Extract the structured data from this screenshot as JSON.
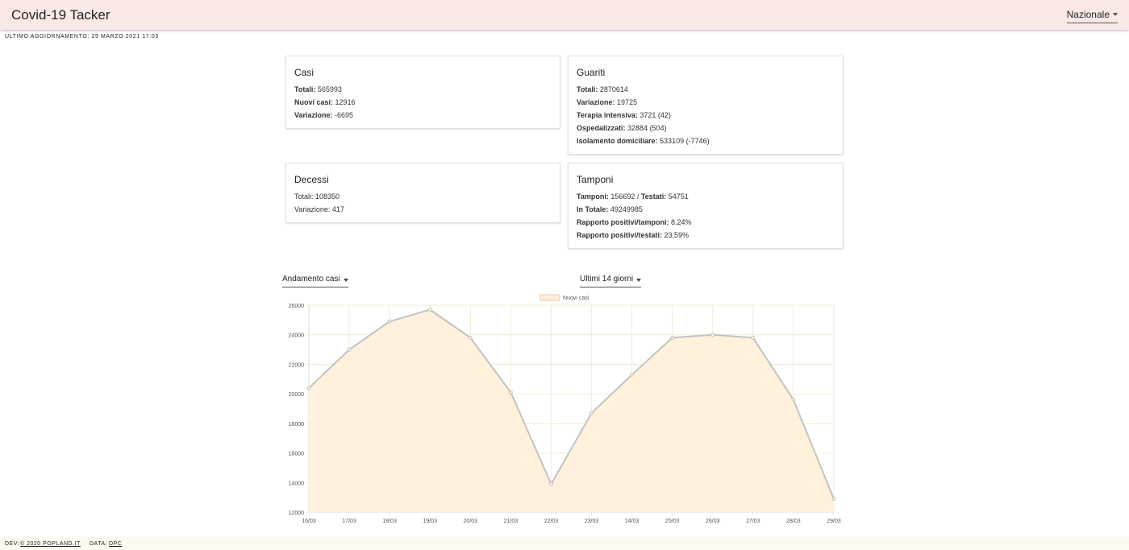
{
  "header": {
    "title": "Covid-19 Tacker",
    "scope_select": "Nazionale"
  },
  "last_update": "ULTIMO AGGIORNAMENTO: 29 MARZO 2021 17:03",
  "cards": {
    "casi": {
      "title": "Casi",
      "rows": [
        {
          "label": "Totali:",
          "value": "565993"
        },
        {
          "label": "Nuovi casi:",
          "value": "12916"
        },
        {
          "label": "Variazione:",
          "value": "-6695"
        }
      ]
    },
    "guariti": {
      "title": "Guariti",
      "rows": [
        {
          "label": "Totali:",
          "value": "2870614"
        },
        {
          "label": "Variazione:",
          "value": "19725"
        },
        {
          "label": "Terapia intensiva:",
          "value": "3721 (42)"
        },
        {
          "label": "Ospedalizzati:",
          "value": "32884 (504)"
        },
        {
          "label": "Isolamento domiciliare:",
          "value": "533109 (-7746)"
        }
      ]
    },
    "decessi": {
      "title": "Decessi",
      "rows": [
        {
          "text": "Totali: 108350"
        },
        {
          "text": "Variazione: 417"
        }
      ]
    },
    "tamponi": {
      "title": "Tamponi",
      "line1": {
        "label": "Tamponi:",
        "value": "156692 /",
        "label2": "Testati:",
        "value2": "54751"
      },
      "rows": [
        {
          "label": "In Totale:",
          "value": "49249985"
        },
        {
          "label": "Rapporto positivi/tamponi:",
          "value": "8.24%"
        },
        {
          "label": "Rapporto positivi/testati:",
          "value": "23.59%"
        }
      ]
    }
  },
  "controls": {
    "metric_select": "Andamento casi",
    "period_select": "Ultimi 14 giorni"
  },
  "colors": {
    "header_bg": "#fbe9e7",
    "area_fill": "#fff1dc",
    "line": "#c2c2c2"
  },
  "chart_data": {
    "type": "area",
    "categories": [
      "16/03",
      "17/03",
      "18/03",
      "19/03",
      "20/03",
      "21/03",
      "22/03",
      "23/03",
      "24/03",
      "25/03",
      "26/03",
      "27/03",
      "28/03",
      "29/03"
    ],
    "series": [
      {
        "name": "Nuovi casi",
        "values": [
          20400,
          23000,
          24900,
          25700,
          23800,
          20100,
          13900,
          18700,
          21300,
          23800,
          24000,
          23800,
          19600,
          12900
        ]
      }
    ],
    "ylim": [
      12000,
      26000
    ],
    "yticks": [
      12000,
      14000,
      16000,
      18000,
      20000,
      22000,
      24000,
      26000
    ],
    "legend": "top-center",
    "grid": true
  },
  "footer": {
    "dev_label": "DEV:",
    "dev_link": "© 2020 POPLAND.IT",
    "data_label": "DATA:",
    "data_link": "DPC"
  }
}
